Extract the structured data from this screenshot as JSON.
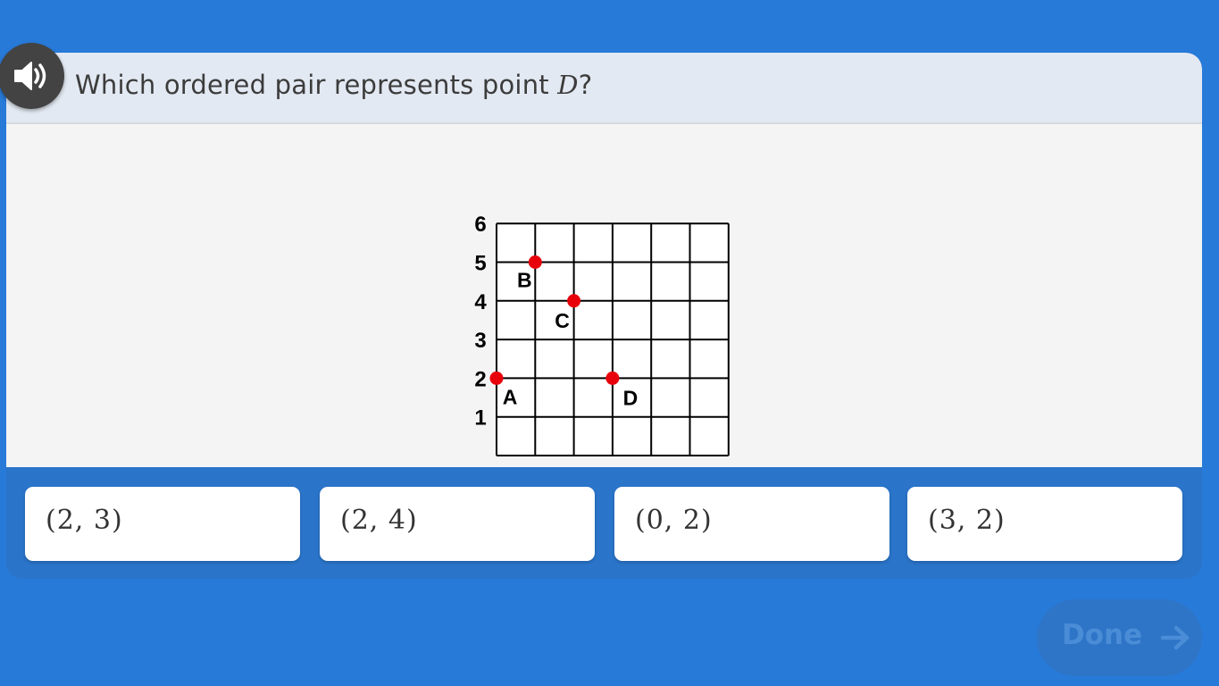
{
  "question": {
    "text_before": "Which ordered pair represents point ",
    "variable": "D",
    "text_after": "?"
  },
  "audio": {
    "icon": "speaker-volume-icon"
  },
  "chart_data": {
    "type": "scatter",
    "title": "",
    "xlim": [
      0,
      6
    ],
    "ylim": [
      0,
      6
    ],
    "grid": true,
    "x_ticks": [
      "0",
      "1",
      "2",
      "3",
      "4",
      "5",
      "6"
    ],
    "y_ticks": [
      "1",
      "2",
      "3",
      "4",
      "5",
      "6"
    ],
    "points": [
      {
        "label": "A",
        "x": 0,
        "y": 2
      },
      {
        "label": "B",
        "x": 1,
        "y": 5
      },
      {
        "label": "C",
        "x": 2,
        "y": 4
      },
      {
        "label": "D",
        "x": 3,
        "y": 2
      }
    ],
    "point_color": "#e8000b"
  },
  "choices": [
    {
      "label": "(2,  3)"
    },
    {
      "label": "(2,  4)"
    },
    {
      "label": "(0,  2)"
    },
    {
      "label": "(3,  2)"
    }
  ],
  "done_button": {
    "label": "Done",
    "icon": "arrow-right-icon",
    "enabled": false
  }
}
